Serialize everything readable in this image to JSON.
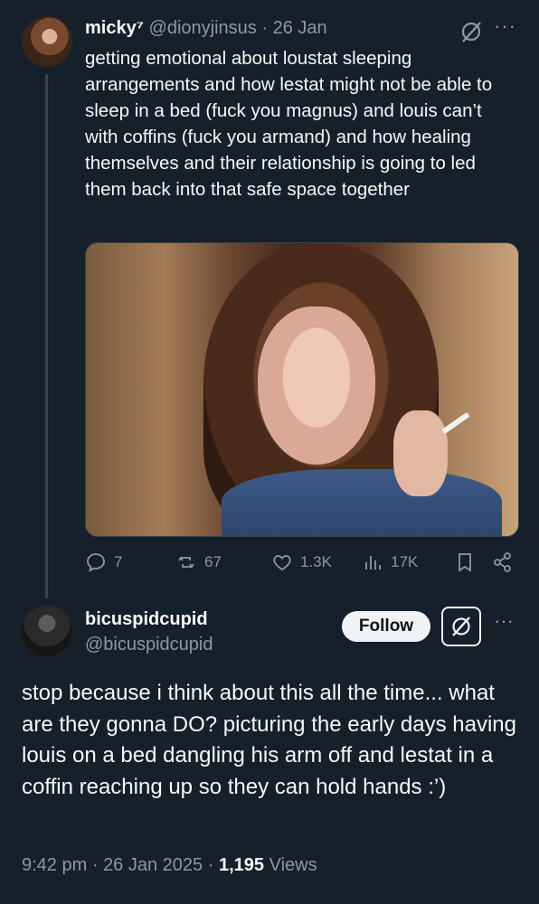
{
  "tweet1": {
    "display_name": "micky⁷",
    "handle": "@dionyjinsus",
    "separator": "·",
    "date": "26 Jan",
    "text": "getting emotional about loustat sleeping arrangements and how lestat might not be able to sleep in a bed (fuck you magnus) and louis can’t with coffins (fuck you armand) and how healing themselves and their relationship is going to led them back into that safe space together",
    "actions": {
      "replies": "7",
      "reposts": "67",
      "likes": "1.3K",
      "views": "17K"
    }
  },
  "tweet2": {
    "display_name": "bicuspidcupid",
    "handle": "@bicuspidcupid",
    "follow_label": "Follow",
    "text": "stop because i think about this all the time... what are they gonna DO? picturing the early days having louis on a bed dangling his arm off and lestat in a coffin reaching up so they can hold hands :’)",
    "time": "9:42 pm",
    "date": "26 Jan 2025",
    "views_count": "1,195",
    "views_label": "Views",
    "separator": "·"
  },
  "icons": {
    "more": "more-icon",
    "grok": "grok-icon",
    "reply": "reply-icon",
    "repost": "repost-icon",
    "like": "like-icon",
    "views": "views-icon",
    "bookmark": "bookmark-icon",
    "share": "share-icon"
  },
  "colors": {
    "background": "#15202b",
    "text_primary": "#f7f9f9",
    "text_secondary": "#8b98a5",
    "follow_bg": "#eff3f4"
  }
}
